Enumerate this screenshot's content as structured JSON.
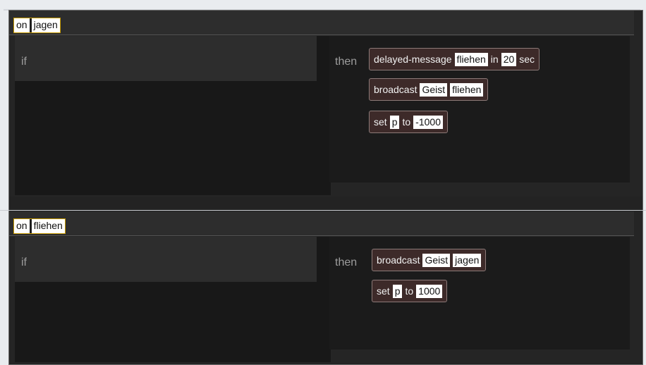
{
  "handlers": [
    {
      "on_keyword": "on",
      "message": "jagen",
      "if_label": "if",
      "then_label": "then",
      "statements": [
        {
          "cmd": "delayed-message",
          "message": "fliehen",
          "in_label": "in",
          "delay": "20",
          "unit": "sec"
        },
        {
          "cmd": "broadcast",
          "target": "Geist",
          "message": "fliehen"
        },
        {
          "cmd": "set",
          "variable": "p",
          "to_label": "to",
          "value": "-1000"
        }
      ]
    },
    {
      "on_keyword": "on",
      "message": "fliehen",
      "if_label": "if",
      "then_label": "then",
      "statements": [
        {
          "cmd": "broadcast",
          "target": "Geist",
          "message": "jagen"
        },
        {
          "cmd": "set",
          "variable": "p",
          "to_label": "to",
          "value": "1000"
        }
      ]
    }
  ]
}
